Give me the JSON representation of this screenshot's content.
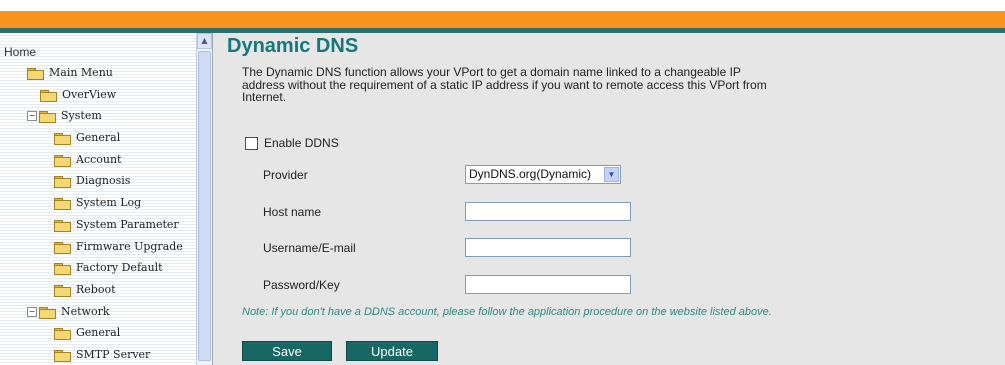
{
  "sidebar": {
    "home": "Home",
    "items": [
      {
        "label": "Main Menu",
        "expander": ""
      },
      {
        "label": "OverView",
        "expander": ""
      },
      {
        "label": "System",
        "expander": "−"
      },
      {
        "label": "General",
        "expander": ""
      },
      {
        "label": "Account",
        "expander": ""
      },
      {
        "label": "Diagnosis",
        "expander": ""
      },
      {
        "label": "System Log",
        "expander": ""
      },
      {
        "label": "System Parameter",
        "expander": ""
      },
      {
        "label": "Firmware Upgrade",
        "expander": ""
      },
      {
        "label": "Factory Default",
        "expander": ""
      },
      {
        "label": "Reboot",
        "expander": ""
      },
      {
        "label": "Network",
        "expander": "−"
      },
      {
        "label": "General",
        "expander": ""
      },
      {
        "label": "SMTP Server",
        "expander": ""
      }
    ],
    "scroll_up_glyph": "▲"
  },
  "main": {
    "title": "Dynamic DNS",
    "description": "The Dynamic DNS function allows your VPort to get a domain name linked to a changeable IP address without the requirement of a static IP address if you want to remote access this VPort from Internet.",
    "enable_label": "Enable DDNS",
    "enable_checked": false,
    "provider_label": "Provider",
    "provider_value": "DynDNS.org(Dynamic)",
    "select_arrow_glyph": "▼",
    "host_label": "Host name",
    "host_value": "",
    "username_label": "Username/E-mail",
    "username_value": "",
    "password_label": "Password/Key",
    "password_value": "",
    "note": "Note: If you don't have a DDNS account, please follow the application procedure on the website listed above.",
    "save_label": "Save",
    "update_label": "Update"
  },
  "colors": {
    "accent_orange": "#f7941d",
    "title_teal": "#14777a",
    "button_teal": "#176765",
    "note_teal": "#2e8a84",
    "content_bg": "#e6e6e6"
  }
}
